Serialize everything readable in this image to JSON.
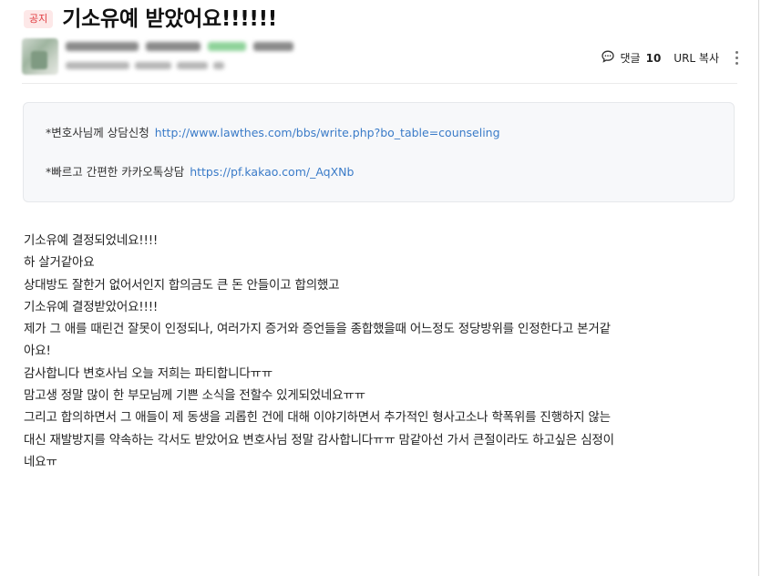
{
  "post": {
    "badge": "공지",
    "title": "기소유예 받았어요!!!!!!"
  },
  "tools": {
    "comment_label": "댓글",
    "comment_count": "10",
    "url_copy": "URL 복사"
  },
  "info_box": {
    "line1_label": "*변호사님께 상담신청",
    "line1_link": "http://www.lawthes.com/bbs/write.php?bo_table=counseling",
    "line2_label": "*빠르고 간편한 카카오톡상담",
    "line2_link": "https://pf.kakao.com/_AqXNb"
  },
  "content": {
    "lines": [
      "기소유예 결정되었네요!!!!",
      "하 살거같아요",
      "상대방도 잘한거 없어서인지 합의금도 큰 돈 안들이고 합의했고",
      "기소유예 결정받았어요!!!!",
      "제가 그 애를 때린건 잘못이 인정되나, 여러가지 증거와 증언들을 종합했을때 어느정도 정당방위를 인정한다고 본거같",
      "아요!",
      "감사합니다 변호사님 오늘 저희는 파티합니다ㅠㅠ",
      "맘고생 정말 많이 한 부모님께 기쁜 소식을 전할수 있게되었네요ㅠㅠ",
      "그리고 합의하면서 그 애들이 제 동생을 괴롭힌 건에 대해 이야기하면서 추가적인 형사고소나 학폭위를 진행하지 않는",
      "대신 재발방지를 약속하는 각서도 받았어요 변호사님 정말 감사합니다ㅠㅠ 맘같아선 가서 큰절이라도 하고싶은 심정이",
      "네요ㅠ"
    ]
  }
}
